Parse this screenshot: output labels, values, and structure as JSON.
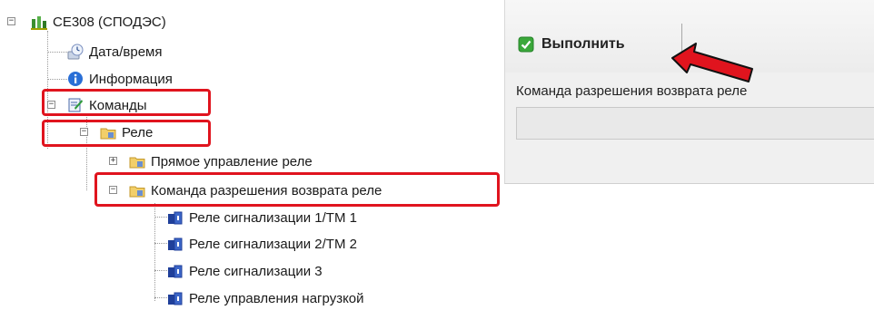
{
  "tree": {
    "root": "CE308 (СПОДЭС)",
    "datetime": "Дата/время",
    "info": "Информация",
    "commands": "Команды",
    "relay": "Реле",
    "direct_control": "Прямое управление реле",
    "return_permission": "Команда разрешения возврата реле",
    "leaves": [
      "Реле сигнализации 1/ТМ 1",
      "Реле сигнализации 2/ТМ 2",
      "Реле сигнализации 3",
      "Реле управления нагрузкой"
    ]
  },
  "panel": {
    "execute_label": "Выполнить",
    "command_caption": "Команда разрешения возврата реле",
    "command_value": ""
  },
  "colors": {
    "highlight": "#e0141e",
    "check_green": "#3aa83a"
  }
}
